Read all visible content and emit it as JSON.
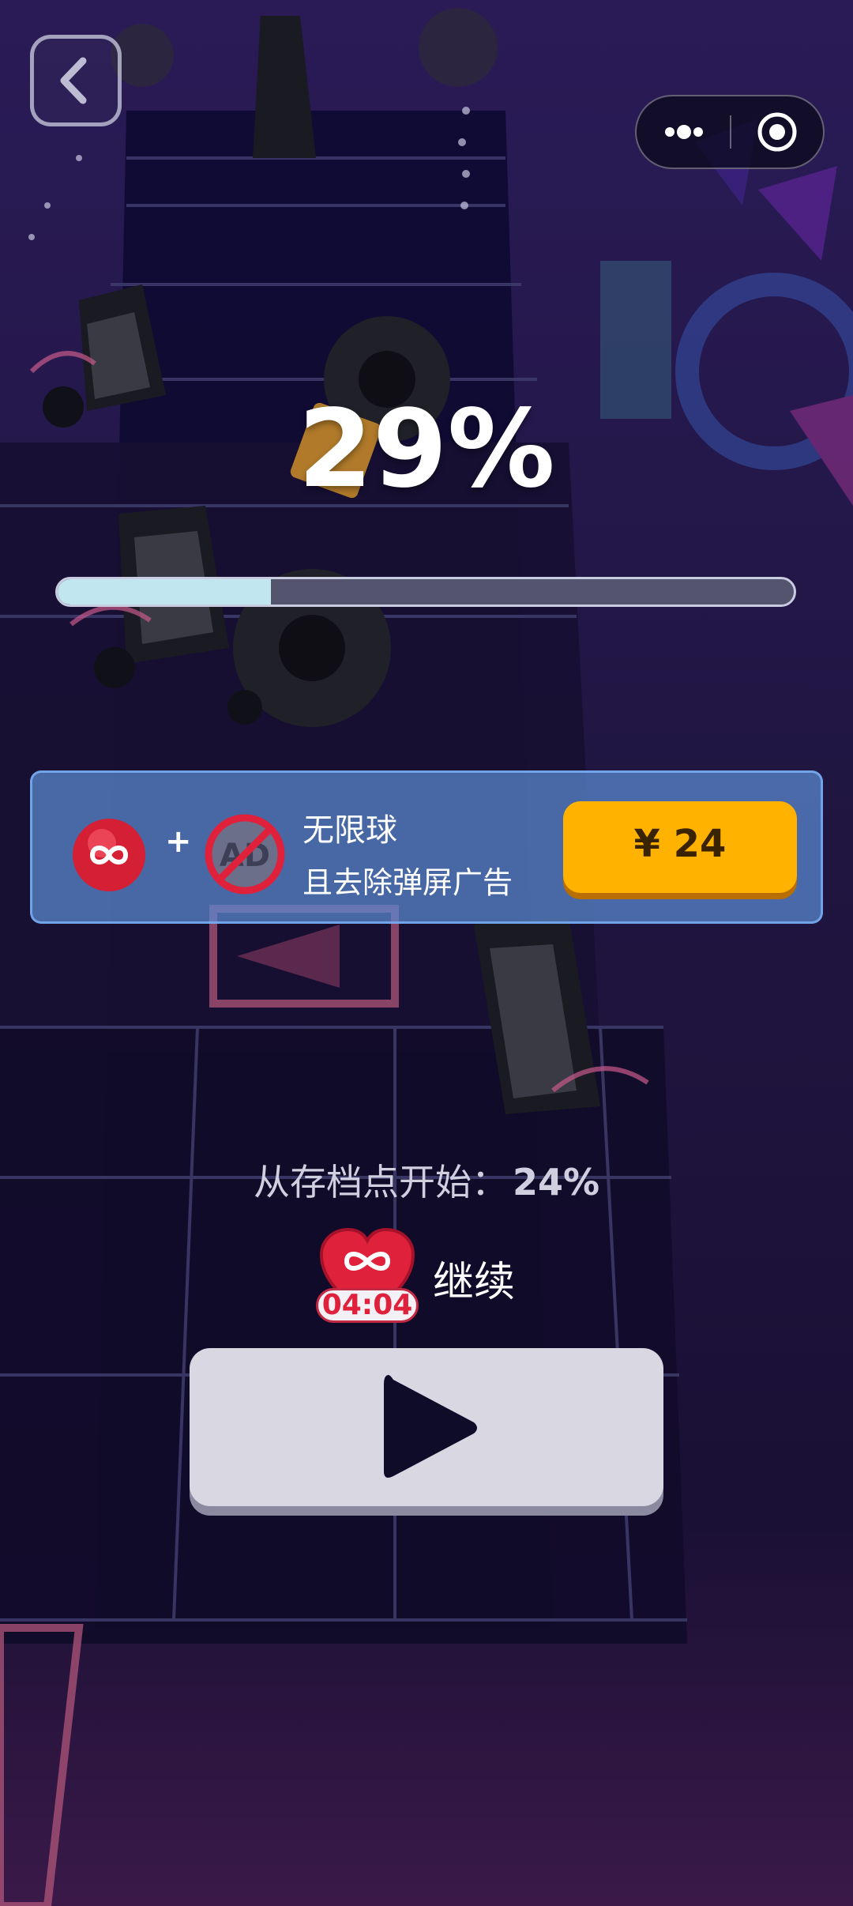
{
  "topbar": {
    "back_icon": "chevron-left-icon",
    "more_icon": "more-dots-icon",
    "close_icon": "target-circle-icon"
  },
  "level": {
    "percent_text": "29%",
    "progress_fraction": 0.29
  },
  "offer": {
    "item_icon": "infinity-ball-icon",
    "plus": "+",
    "noad_icon": "no-ad-icon",
    "noad_text": "AD",
    "title": "无限球",
    "subtitle": "且去除弹屏广告",
    "price": "¥ 24"
  },
  "checkpoint": {
    "label": "从存档点开始：",
    "value": "24%"
  },
  "continue": {
    "icon": "infinity-heart-icon",
    "timer": "04:04",
    "label": "继续"
  },
  "play": {
    "icon": "play-triangle-icon"
  },
  "colors": {
    "price_button": "#ffb300",
    "panel": "#5c8ad2",
    "heart": "#e0213c",
    "progress_fill": "#c2e6f0"
  }
}
